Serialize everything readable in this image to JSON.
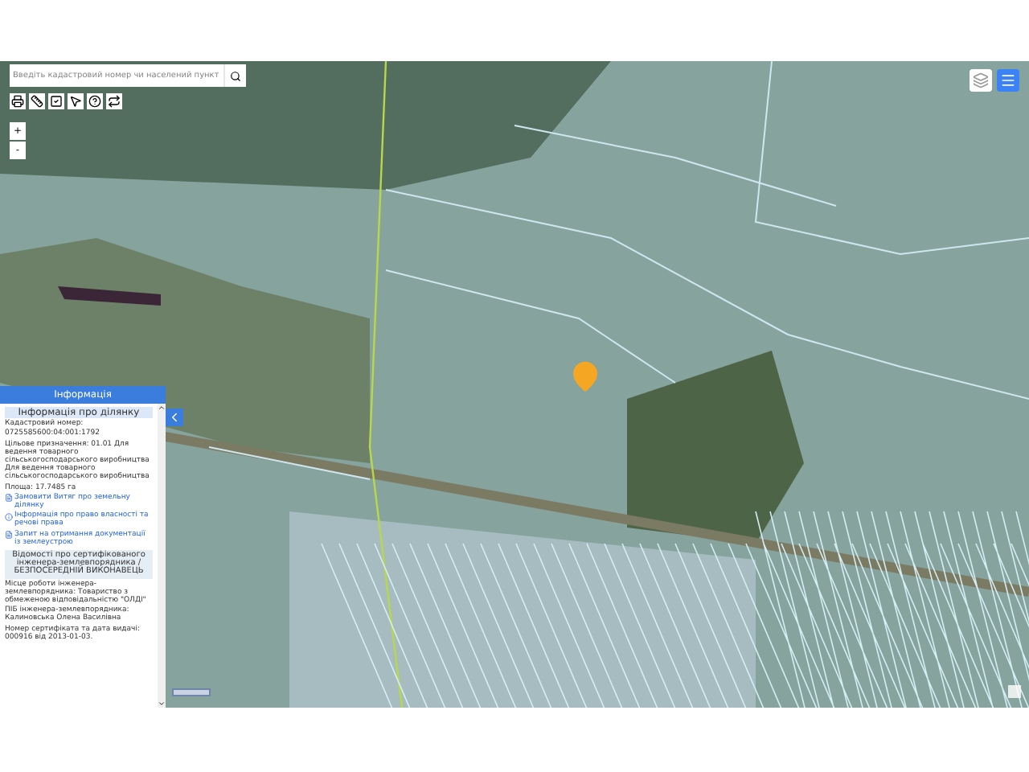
{
  "search": {
    "placeholder": "Введіть кадастровий номер чи населений пункт"
  },
  "zoom": [
    "+",
    "-"
  ],
  "info_panel": {
    "title": "Інформація",
    "section_title": "Інформація про ділянку",
    "fields": [
      "Кадастровий номер:",
      "0725585600:04:001:1792",
      "Цільове призначення: 01.01 Для ведення товарного сільськогосподарського виробництва Для ведення товарного сільськогосподарського виробництва",
      "Площа: 17.7485 га"
    ],
    "links": [
      {
        "kind": "order",
        "text": "Замовити Витяг про земельну ділянку"
      },
      {
        "kind": "info",
        "text": "Інформація про право власності та речові права"
      },
      {
        "kind": "order",
        "text": "Запит на отримання документації із землеустрою"
      }
    ],
    "cert_title": "Відомості про сертифікованого інженера-землевпорядника / БЕЗПОСЕРЕДНІЙ ВИКОНАВЕЦЬ",
    "cert_fields": [
      "Місце роботи інженера-землевпорядника: Товариство з обмеженою відповідальністю \"ОЛДІ\"",
      "ПІБ інженера-землевпорядника: Калиновська Олена Василівна",
      "Номер сертифіката та дата видачі: 000916 від 2013-01-03."
    ]
  }
}
